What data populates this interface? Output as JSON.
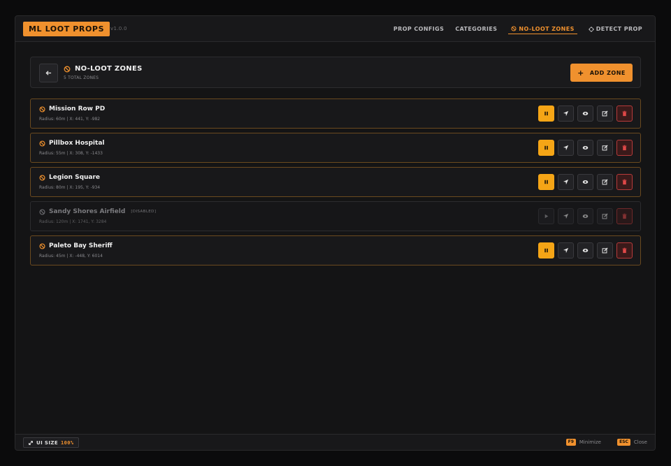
{
  "app": {
    "logo": "ML LOOT PROPS",
    "version": "v1.0.0"
  },
  "nav": {
    "items": [
      {
        "label": "PROP CONFIGS",
        "icon": ""
      },
      {
        "label": "CATEGORIES",
        "icon": ""
      },
      {
        "label": "NO-LOOT ZONES",
        "icon": "ban-icon",
        "active": true
      },
      {
        "label": "DETECT PROP",
        "icon": "crosshair-icon"
      }
    ]
  },
  "section": {
    "title": "NO-LOOT ZONES",
    "subtitle": "5 TOTAL ZONES",
    "add_button": "ADD ZONE"
  },
  "zones": [
    {
      "name": "Mission Row PD",
      "info": "Radius: 60m | X: 441, Y: -982",
      "enabled": true,
      "tag": ""
    },
    {
      "name": "Pillbox Hospital",
      "info": "Radius: 55m | X: 308, Y: -1433",
      "enabled": true,
      "tag": ""
    },
    {
      "name": "Legion Square",
      "info": "Radius: 80m | X: 195, Y: -934",
      "enabled": true,
      "tag": ""
    },
    {
      "name": "Sandy Shores Airfield",
      "info": "Radius: 120m | X: 1741, Y: 3284",
      "enabled": false,
      "tag": "[DISABLED]"
    },
    {
      "name": "Paleto Bay Sheriff",
      "info": "Radius: 45m | X: -448, Y: 6014",
      "enabled": true,
      "tag": ""
    }
  ],
  "footer": {
    "ui_size_label": "UI SIZE",
    "ui_size_value": "100%",
    "minimize_key": "F9",
    "minimize_label": "Minimize",
    "close_key": "ESC",
    "close_label": "Close"
  },
  "colors": {
    "accent": "#f0912e",
    "pause": "#f5a516",
    "danger": "#b83a3a"
  }
}
